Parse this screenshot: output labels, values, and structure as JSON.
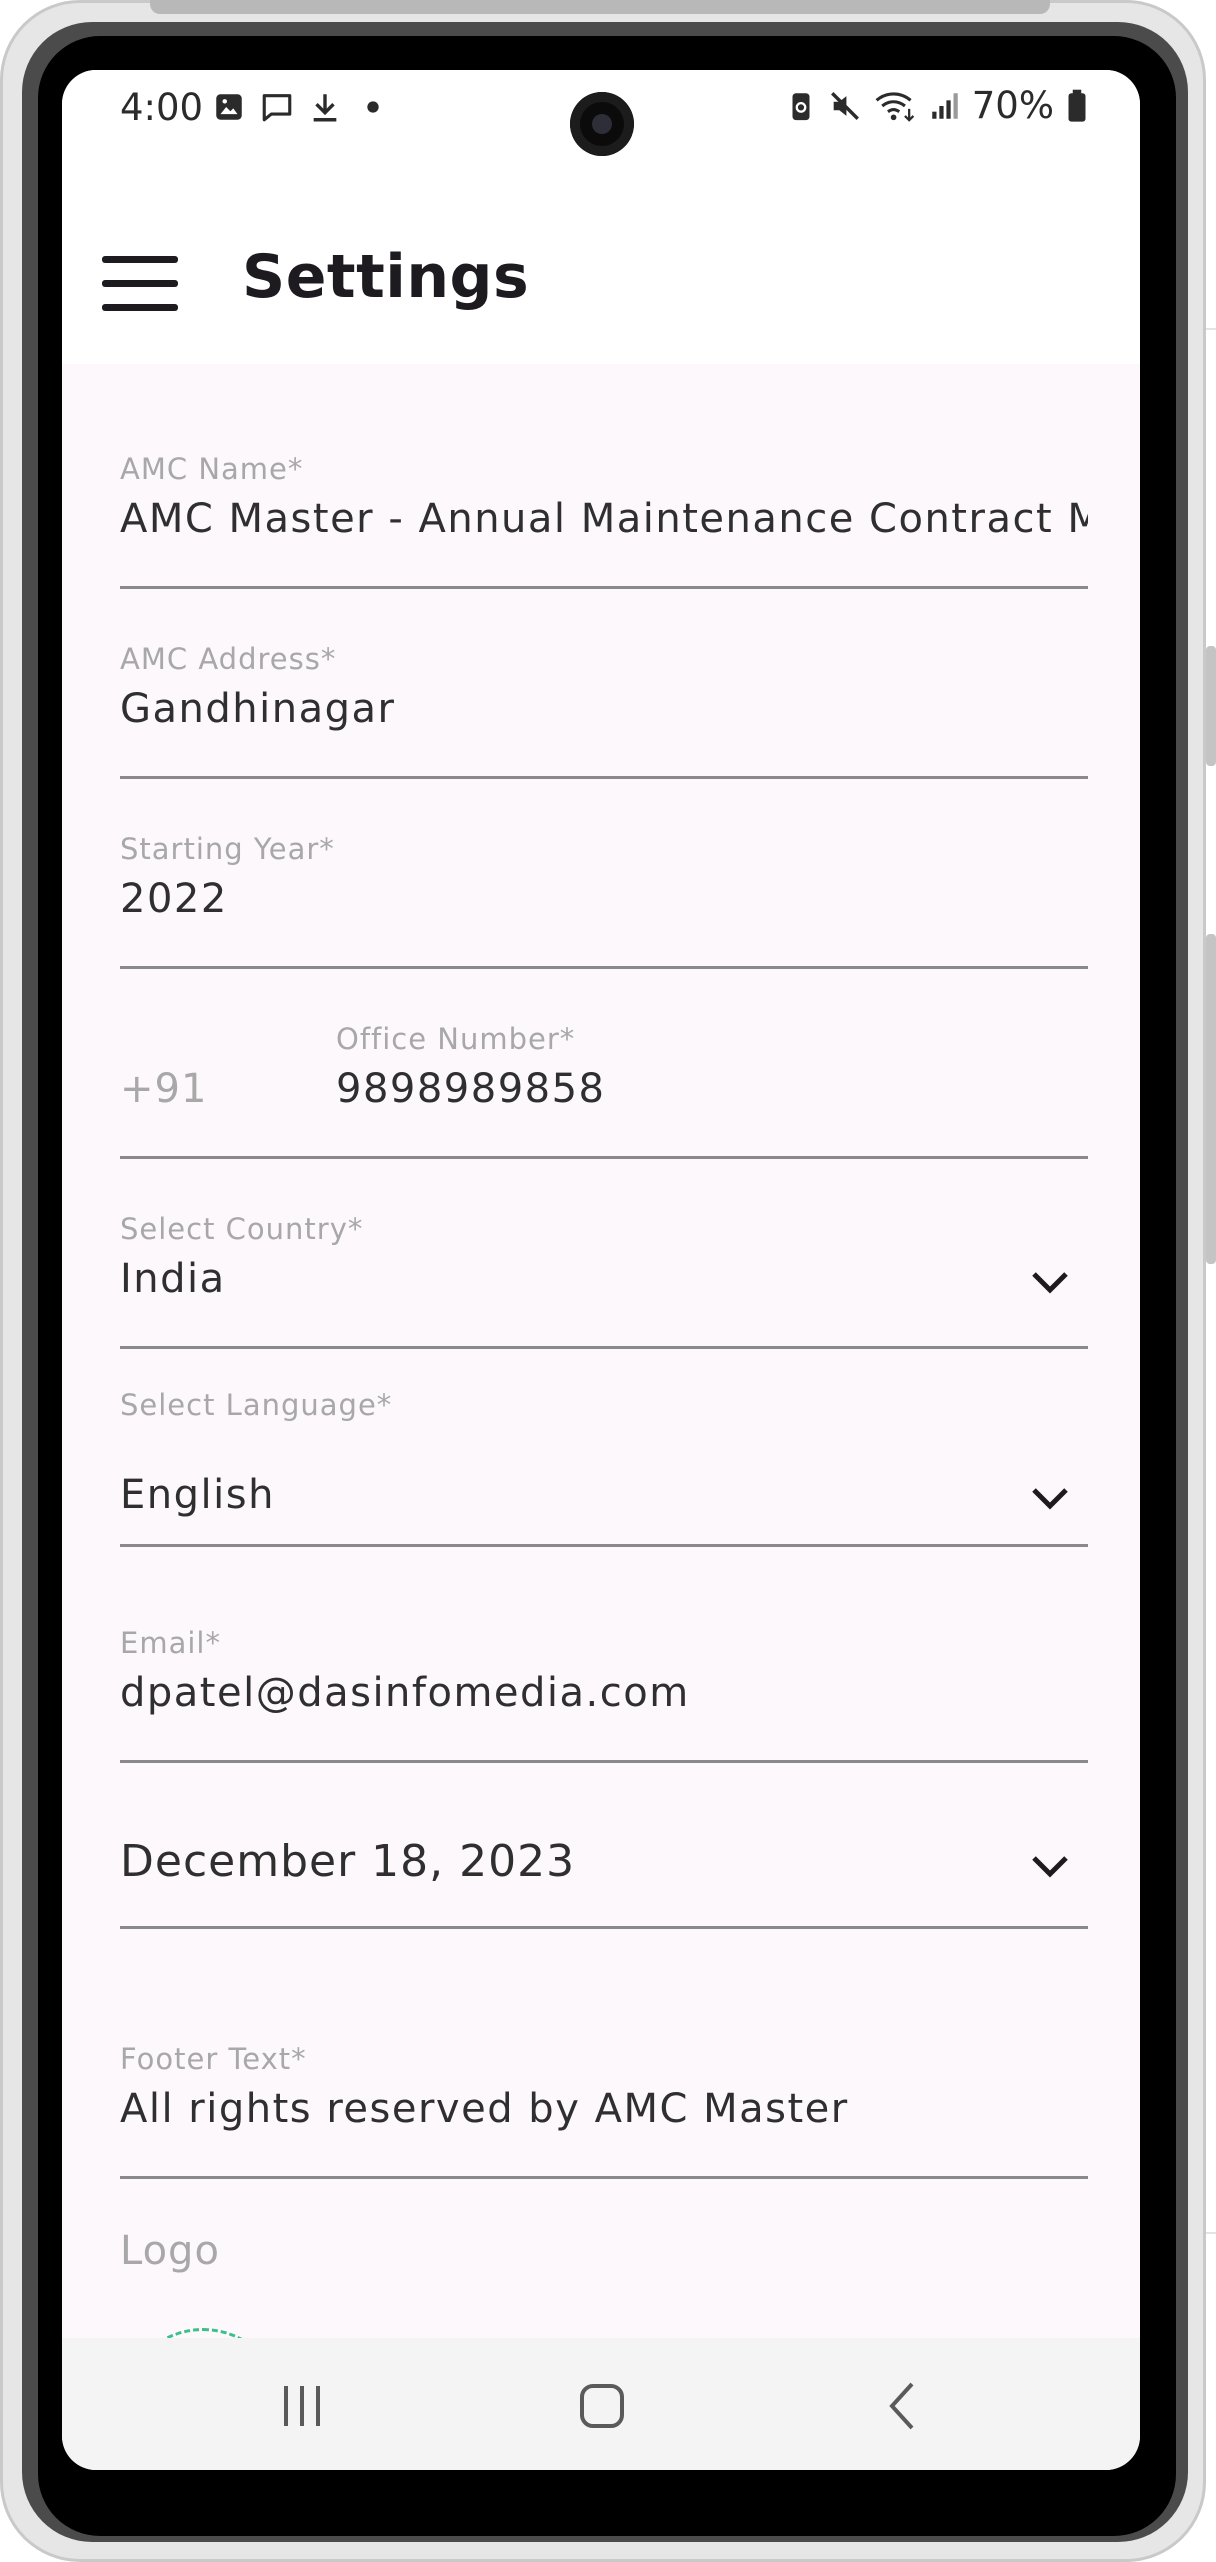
{
  "status_bar": {
    "time": "4:00",
    "battery": "70%",
    "icons_left": [
      "image-icon",
      "message-icon",
      "download-icon",
      "dot-icon"
    ],
    "icons_right": [
      "battery-saver-icon",
      "mute-icon",
      "wifi-icon",
      "signal-icon",
      "battery-icon"
    ]
  },
  "app_bar": {
    "title": "Settings"
  },
  "form": {
    "amc_name": {
      "label": "AMC Name*",
      "value": "AMC Master - Annual Maintenance Contract M"
    },
    "amc_address": {
      "label": "AMC Address*",
      "value": "Gandhinagar"
    },
    "starting_year": {
      "label": "Starting Year*",
      "value": "2022"
    },
    "office_number": {
      "label": "Office Number*",
      "prefix": "+91",
      "value": "9898989858"
    },
    "country": {
      "label": "Select Country*",
      "value": "India"
    },
    "language": {
      "label": "Select Language*",
      "value": "English"
    },
    "email": {
      "label": "Email*",
      "value": "dpatel@dasinfomedia.com"
    },
    "date": {
      "value": "December 18, 2023"
    },
    "footer_text": {
      "label": "Footer Text*",
      "value": "All rights reserved by AMC Master"
    },
    "logo": {
      "label": "Logo"
    }
  },
  "colors": {
    "background": "#fdf8fb",
    "text": "#2f2f2f",
    "label": "#a8a8a8",
    "underline": "#8a8a8a",
    "logo_green": "#22c07a",
    "logo_blue": "#1aa3e8"
  }
}
